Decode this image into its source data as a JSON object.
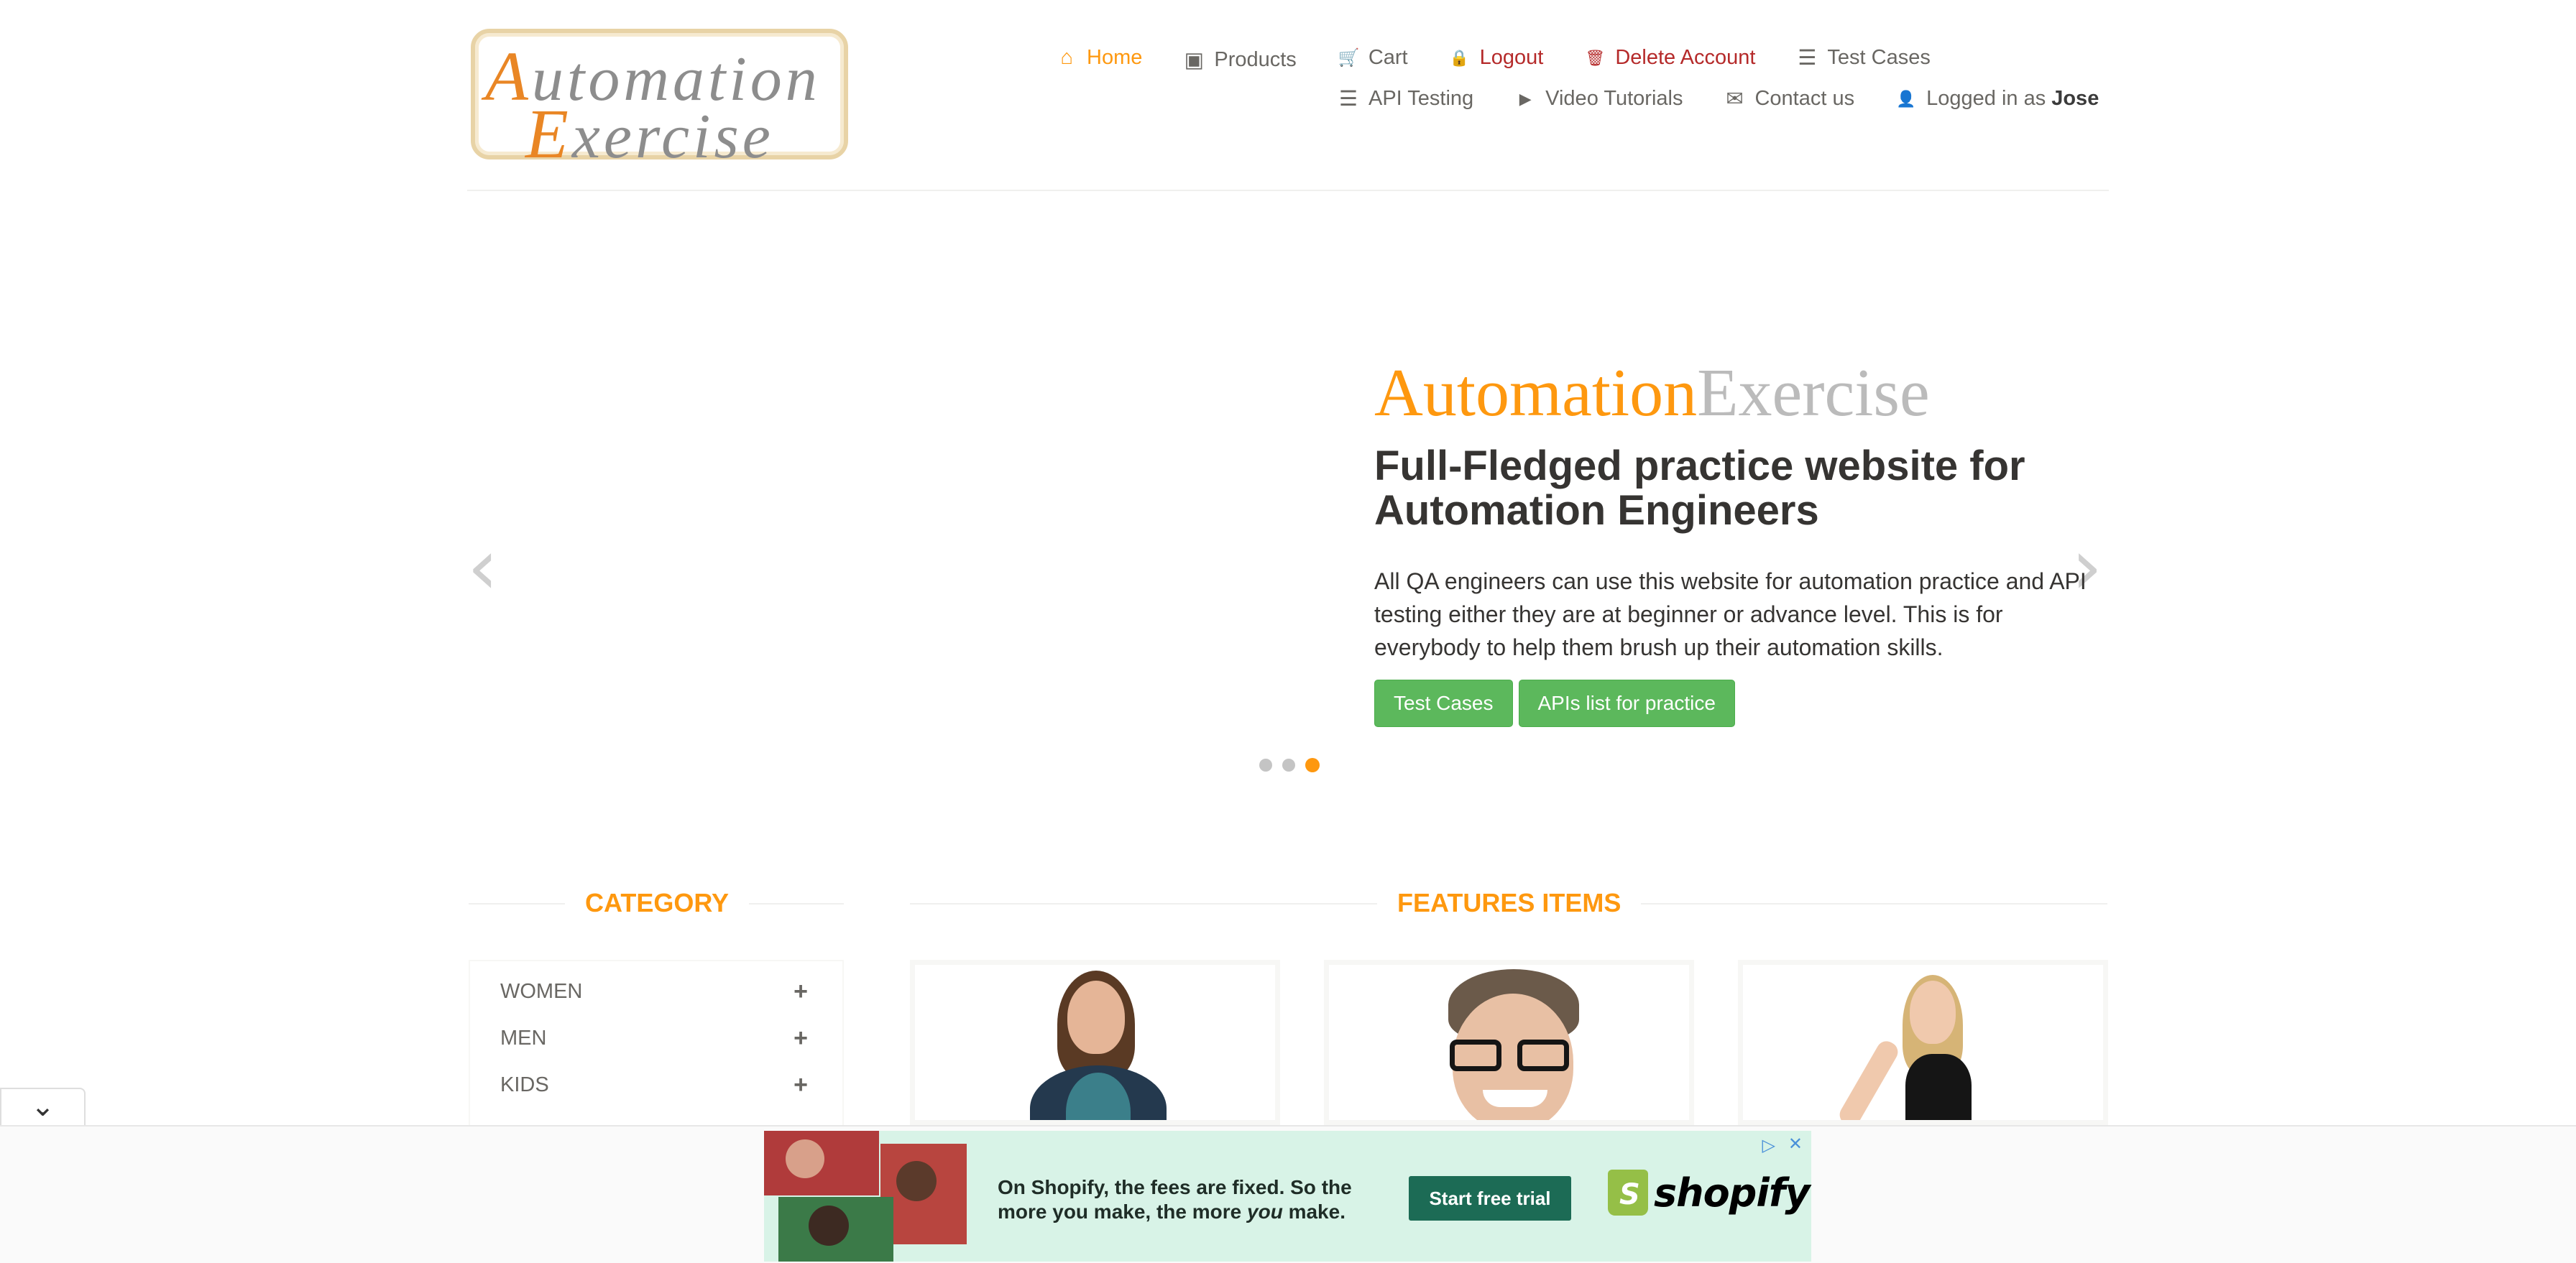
{
  "header": {
    "logo": {
      "line1": "Automation",
      "line2": "Exercise"
    },
    "nav_row1": [
      {
        "icon": "home-icon",
        "glyph": "⌂",
        "label": "Home"
      },
      {
        "icon": "briefcase-icon",
        "glyph": "▣",
        "label": "Products"
      },
      {
        "icon": "cart-icon",
        "glyph": "🛒",
        "label": "Cart"
      },
      {
        "icon": "lock-icon",
        "glyph": "🔒",
        "label": "Logout"
      },
      {
        "icon": "trash-icon",
        "glyph": "🗑",
        "label": "Delete Account"
      },
      {
        "icon": "list-icon",
        "glyph": "☰",
        "label": "Test Cases"
      }
    ],
    "nav_row2": [
      {
        "icon": "list-icon",
        "glyph": "☰",
        "label": "API Testing"
      },
      {
        "icon": "youtube-play-icon",
        "glyph": "▶",
        "label": "Video Tutorials"
      },
      {
        "icon": "envelope-icon",
        "glyph": "✉",
        "label": "Contact us"
      },
      {
        "icon": "user-icon",
        "glyph": "👤",
        "label": "Logged in as",
        "user": "Jose"
      }
    ]
  },
  "slider": {
    "brand_part1": "Automation",
    "brand_part2": "Exercise",
    "headline": "Full-Fledged practice website for Automation Engineers",
    "description": "All QA engineers can use this website for automation practice and API testing either they are at beginner or advance level. This is for everybody to help them brush up their automation skills.",
    "button_test_cases": "Test Cases",
    "button_apis": "APIs list for practice",
    "prev_glyph": "‹",
    "next_glyph": "›",
    "active_slide": 3,
    "slide_count": 3
  },
  "category": {
    "title": "CATEGORY",
    "items": [
      {
        "label": "WOMEN",
        "toggle": "+"
      },
      {
        "label": "MEN",
        "toggle": "+"
      },
      {
        "label": "KIDS",
        "toggle": "+"
      }
    ]
  },
  "features": {
    "title": "FEATURES ITEMS"
  },
  "ad": {
    "collapse_glyph": "⌄",
    "text_line1": "On Shopify, the fees are fixed. So the",
    "text_line2_a": "more you make, the more ",
    "text_line2_em": "you",
    "text_line2_b": " make.",
    "cta": "Start free trial",
    "brand": "shopify",
    "brand_mark": "S",
    "adchoices_glyph": "▷",
    "close_glyph": "✕"
  },
  "colors": {
    "accent": "#fe980f",
    "danger": "#b52a2a",
    "button_green": "#5cb85c",
    "ad_background": "#d8f3e7",
    "ad_button": "#1c6b55",
    "shopify_green": "#95bf47"
  }
}
